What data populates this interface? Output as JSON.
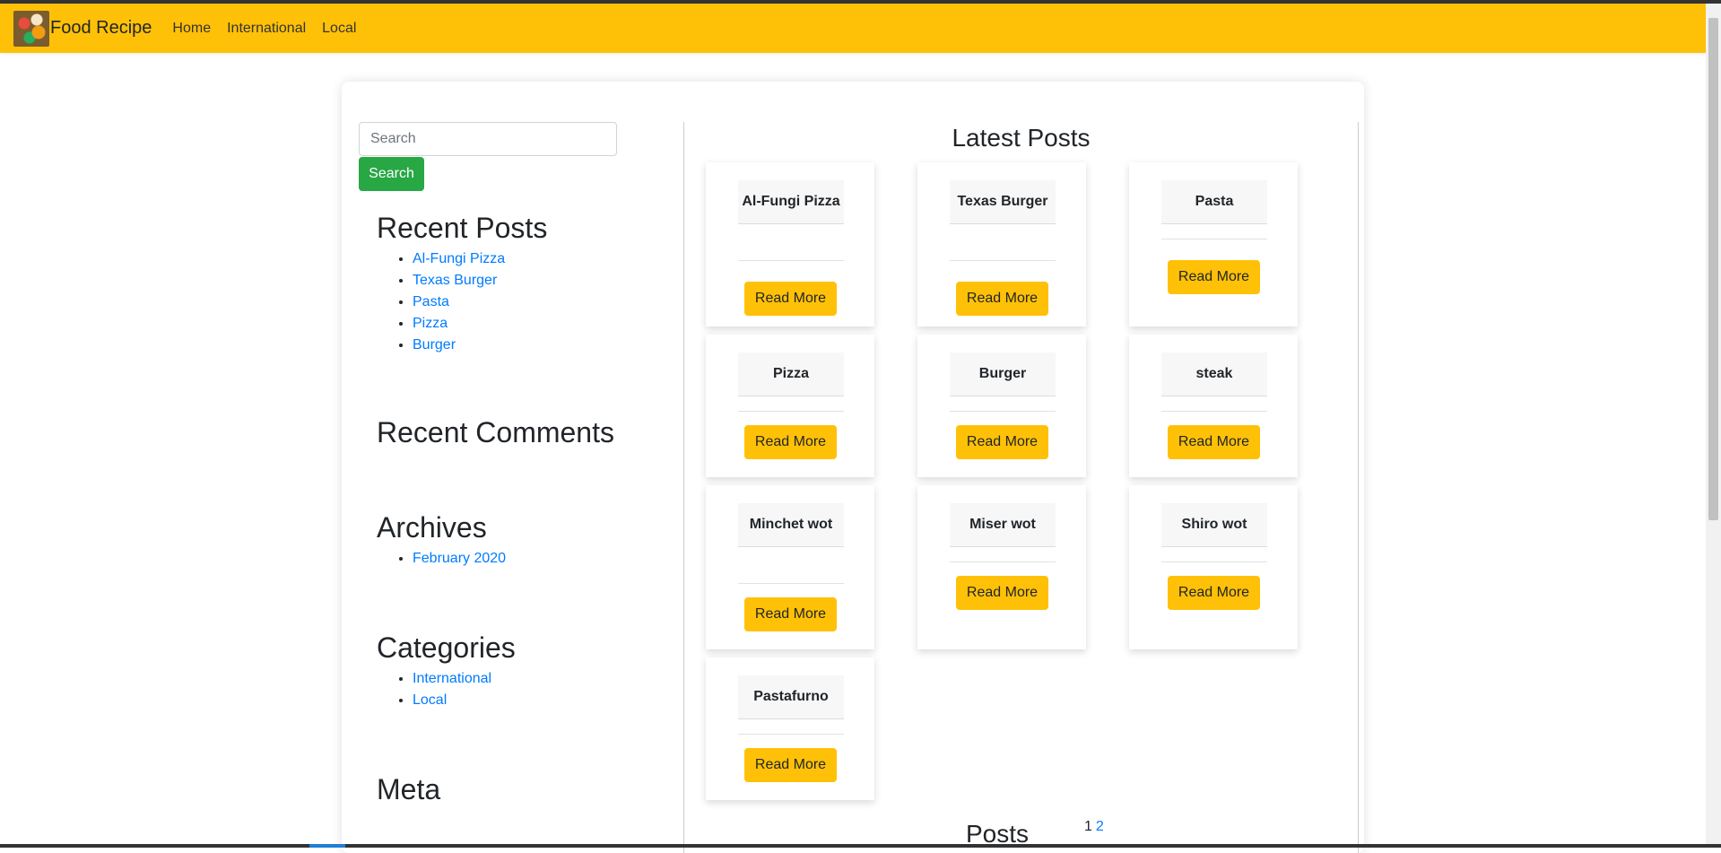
{
  "navbar": {
    "brand": "Food Recipe",
    "links": [
      "Home",
      "International",
      "Local"
    ]
  },
  "search": {
    "placeholder": "Search",
    "button_label": "Search"
  },
  "sidebar": {
    "recent_posts": {
      "title": "Recent Posts",
      "items": [
        "Al-Fungi Pizza",
        "Texas Burger",
        "Pasta",
        "Pizza",
        "Burger"
      ]
    },
    "recent_comments": {
      "title": "Recent Comments"
    },
    "archives": {
      "title": "Archives",
      "items": [
        "February 2020"
      ]
    },
    "categories": {
      "title": "Categories",
      "items": [
        "International",
        "Local"
      ]
    },
    "meta": {
      "title": "Meta"
    }
  },
  "main": {
    "title": "Latest Posts",
    "read_more_label": "Read More",
    "posts": [
      {
        "title": "Al-Fungi Pizza"
      },
      {
        "title": "Texas Burger"
      },
      {
        "title": "Pasta"
      },
      {
        "title": "Pizza"
      },
      {
        "title": "Burger"
      },
      {
        "title": "steak"
      },
      {
        "title": "Minchet wot"
      },
      {
        "title": "Miser wot"
      },
      {
        "title": "Shiro wot"
      },
      {
        "title": "Pastafurno"
      }
    ],
    "posts_heading": "Posts",
    "pagination": {
      "current": "1",
      "next": "2"
    }
  },
  "colors": {
    "navbar": "#ffc107",
    "search_button": "#28a745",
    "read_more_button": "#ffc107",
    "link": "#007bff"
  }
}
